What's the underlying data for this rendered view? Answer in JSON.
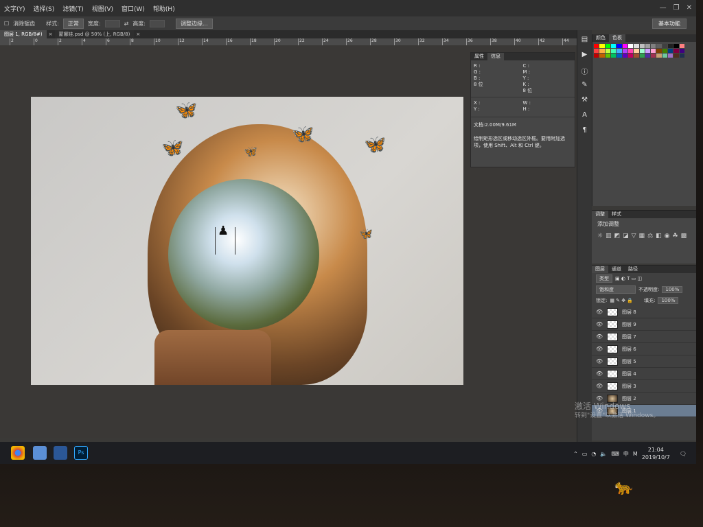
{
  "menubar": {
    "items": [
      "文字(Y)",
      "选择(S)",
      "滤镜(T)",
      "视图(V)",
      "窗口(W)",
      "帮助(H)"
    ]
  },
  "options_bar": {
    "antialias_label": "消除锯齿",
    "style_label": "样式:",
    "style_value": "正常",
    "width_label": "宽度:",
    "height_label": "高度:",
    "refine_button": "调整边缘...",
    "workspace": "基本功能"
  },
  "tabs": [
    {
      "label": "图层 1, RGB/8#)",
      "active": true
    },
    {
      "label": "蒙娜娃.psd @ 50% (上, RGB/8)",
      "active": false
    }
  ],
  "ruler_ticks": [
    "2",
    "0",
    "2",
    "4",
    "6",
    "8",
    "10",
    "12",
    "14",
    "16",
    "18",
    "20",
    "22",
    "24",
    "26",
    "28",
    "30",
    "32",
    "34",
    "36",
    "38",
    "40",
    "42",
    "44"
  ],
  "info_panel": {
    "tabs": [
      "属性",
      "信息"
    ],
    "col1": "R :\nG :\nB :\n8 位",
    "col2": "C :\nM :\nY :\nK :\n8 位",
    "xy": "X :\nY :",
    "wh": "W :\nH :",
    "doc": "文档:2.00M/9.61M",
    "msg": "绘制矩形选区或移动选区外框。要用附加选项，使用 Shift、Alt 和 Ctrl 键。"
  },
  "color_panel": {
    "tabs": [
      "颜色",
      "色板"
    ]
  },
  "swatch_colors": [
    "#ff0000",
    "#ffff00",
    "#00ff00",
    "#00ffff",
    "#0000ff",
    "#ff00ff",
    "#ffffff",
    "#e0e0e0",
    "#c0c0c0",
    "#a0a0a0",
    "#808080",
    "#606060",
    "#404040",
    "#202020",
    "#000000",
    "#ff8080",
    "#ff4040",
    "#ffb040",
    "#c0ff40",
    "#40ffb0",
    "#40b0ff",
    "#b040ff",
    "#ff40b0",
    "#ffd0a0",
    "#a0ffd0",
    "#d0a0ff",
    "#ffa0d0",
    "#804000",
    "#408000",
    "#004080",
    "#800040",
    "#400080",
    "#c00000",
    "#c06000",
    "#60c000",
    "#00c060",
    "#0060c0",
    "#6000c0",
    "#c00060",
    "#a05030",
    "#30a050",
    "#5030a0",
    "#a03050",
    "#c8a070",
    "#70c8a0",
    "#a070c8",
    "#503020",
    "#203050"
  ],
  "adjustments": {
    "tabs": [
      "调整",
      "样式"
    ],
    "title": "添加调整"
  },
  "layers_panel": {
    "tabs": [
      "图层",
      "通道",
      "路径"
    ],
    "kind": "类型",
    "blend": "饱和度",
    "opacity_label": "不透明度:",
    "opacity_value": "100%",
    "lock_label": "锁定:",
    "fill_label": "填充:",
    "fill_value": "100%",
    "layers": [
      {
        "name": "图层 8",
        "thumb": "transparent",
        "active": false
      },
      {
        "name": "图层 9",
        "thumb": "transparent",
        "active": false
      },
      {
        "name": "图层 7",
        "thumb": "transparent",
        "active": false
      },
      {
        "name": "图层 6",
        "thumb": "transparent",
        "active": false
      },
      {
        "name": "图层 5",
        "thumb": "transparent",
        "active": false
      },
      {
        "name": "图层 4",
        "thumb": "transparent",
        "active": false
      },
      {
        "name": "图层 3",
        "thumb": "transparent",
        "active": false
      },
      {
        "name": "图层 2",
        "thumb": "image",
        "active": false
      },
      {
        "name": "图层 1",
        "thumb": "image",
        "active": true
      }
    ]
  },
  "watermark": {
    "line1": "激活 Windows",
    "line2": "转到\"设置\"以激活 Windows。"
  },
  "taskbar": {
    "apps": [
      {
        "name": "chrome-icon",
        "color": "#e8453c"
      },
      {
        "name": "app-icon",
        "color": "#5b8fd6"
      },
      {
        "name": "word-icon",
        "color": "#2b5797"
      },
      {
        "name": "photoshop-icon",
        "color": "#001e36"
      }
    ],
    "ime": "中",
    "ime2": "M",
    "time": "21:04",
    "date": "2019/10/7"
  }
}
